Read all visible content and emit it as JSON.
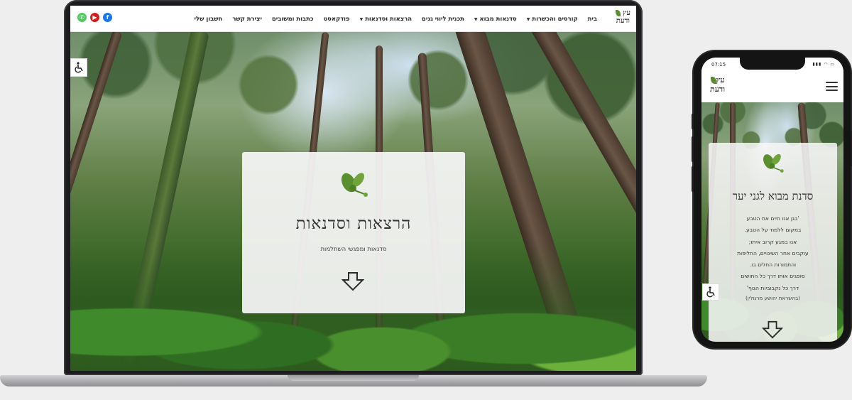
{
  "desktop": {
    "logo": {
      "line1": "עץ",
      "line2": "ודעת"
    },
    "nav": [
      {
        "label": "בית",
        "caret": false
      },
      {
        "label": "קורסים והכשרות",
        "caret": true
      },
      {
        "label": "סדנאות מבוא",
        "caret": true
      },
      {
        "label": "תכנית ליווי גנים",
        "caret": false
      },
      {
        "label": "הרצאות וסדנאות",
        "caret": true
      },
      {
        "label": "פודקאסט",
        "caret": false
      },
      {
        "label": "כתבות ומשובים",
        "caret": false
      },
      {
        "label": "יצירת קשר",
        "caret": false
      },
      {
        "label": "חשבון שלי",
        "caret": false
      }
    ],
    "socials": {
      "whatsapp": "✆",
      "youtube": "▶",
      "facebook": "f"
    },
    "hero_card": {
      "title": "הרצאות וסדנאות",
      "subtitle": "סדנאות ומפגשי השתלמות"
    }
  },
  "mobile": {
    "status": {
      "time": "07:15",
      "indicators": "▮▮▮ ◠ ▭"
    },
    "logo": {
      "line1": "עץ",
      "line2": "ודעת"
    },
    "hero_card": {
      "title": "סדנת מבוא לגני יער",
      "poem": [
        "'בגן אנו חיים את הטבע",
        "במקום ללמוד על הטבע.",
        "אנו במגע קרוב איתו;",
        "עוקבים אחר השינויים, החליפות",
        "והתמורות החלים בו.",
        "סופגים אותו דרך כל החושים",
        "דרך כל נקבוביות הגוף'"
      ],
      "credit": "(בהשראת יהושע מרגולין)"
    }
  },
  "colors": {
    "accent_green": "#5a8f2f",
    "whatsapp": "#4fca5e",
    "youtube": "#d51f1f",
    "facebook": "#1877f2"
  }
}
